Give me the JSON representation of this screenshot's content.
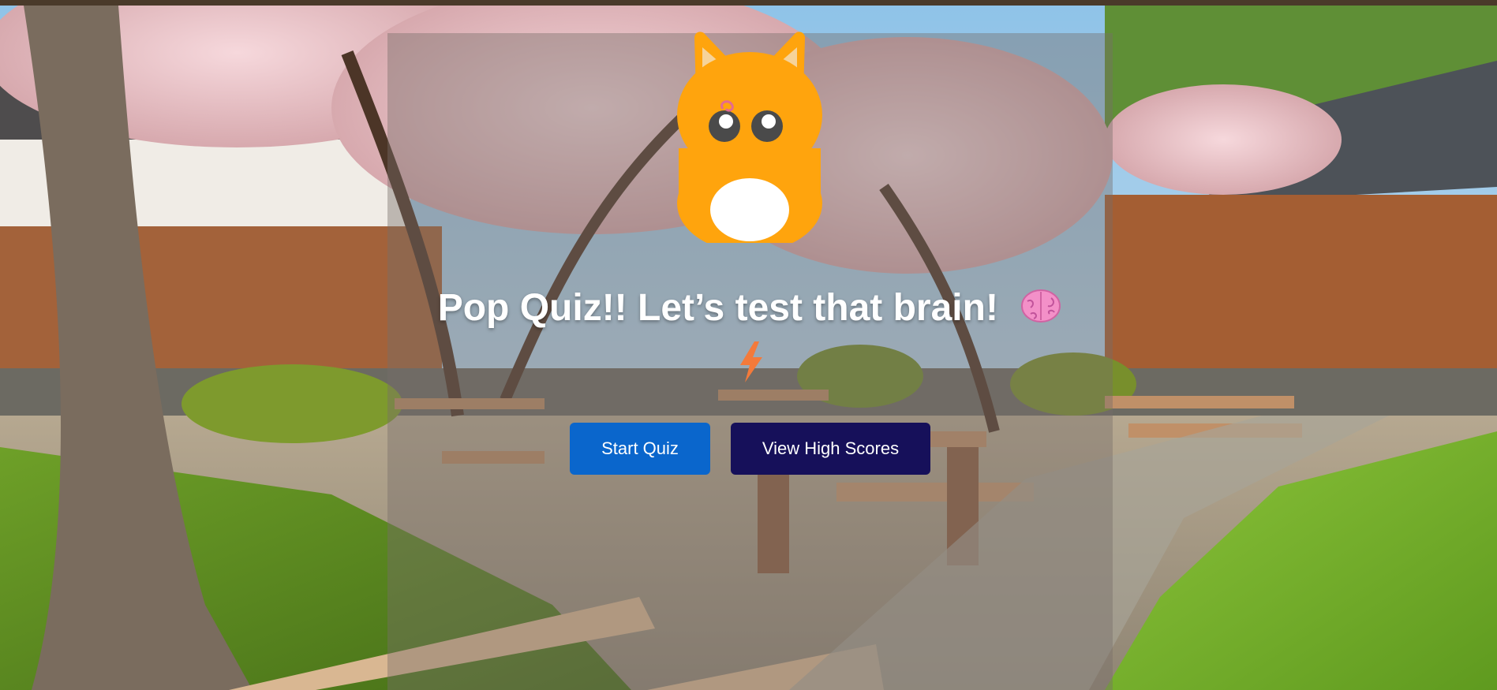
{
  "app": {
    "title": "Pop Quiz!! Let’s test that brain!"
  },
  "icons": {
    "mascot": "orange-cat-mascot",
    "title_emoji": "brain-icon",
    "accent_emoji": "lightning-icon"
  },
  "actions": {
    "start_label": "Start Quiz",
    "high_scores_label": "View High Scores"
  },
  "colors": {
    "start_button": "#0a66cc",
    "high_scores_button": "#16105a",
    "mascot": "#ffa40d",
    "title_text": "#ffffff"
  }
}
